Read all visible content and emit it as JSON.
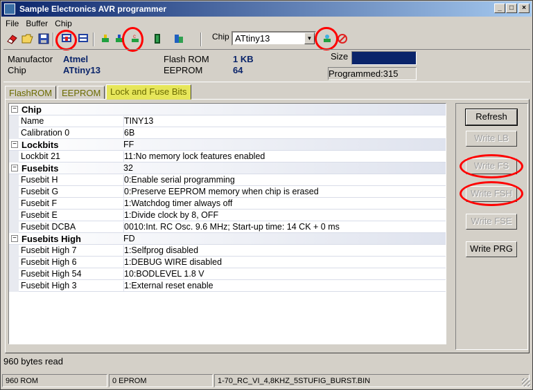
{
  "window": {
    "title": "Sample Electronics AVR programmer"
  },
  "menu": [
    "File",
    "Buffer",
    "Chip"
  ],
  "toolbar": {
    "icons": [
      "eraser-icon",
      "open-folder-icon",
      "save-disk-icon",
      "read-chip-icon",
      "compare-chip-icon",
      "program-chip-icon",
      "read-config-icon",
      "chip-icon",
      "verify-icon"
    ],
    "chip_label": "Chip",
    "chip_value": "ATtiny13"
  },
  "info": {
    "manufacturer_label": "Manufactor",
    "manufacturer_value": "Atmel",
    "chip_label": "Chip",
    "chip_value": "ATtiny13",
    "flash_label": "Flash ROM",
    "flash_value": "1 KB",
    "eeprom_label": "EEPROM",
    "eeprom_value": "64",
    "size_label": "Size",
    "size_fill_fraction": 1.0,
    "programmed": "Programmed:315"
  },
  "tabs": [
    {
      "label": "FlashROM",
      "active": false
    },
    {
      "label": "EEPROM",
      "active": false
    },
    {
      "label": "Lock and Fuse Bits",
      "active": true
    }
  ],
  "grid": {
    "rows": [
      {
        "type": "category",
        "name": "Chip",
        "value": ""
      },
      {
        "type": "item",
        "name": "Name",
        "value": "TINY13"
      },
      {
        "type": "item",
        "name": "Calibration 0",
        "value": "6B"
      },
      {
        "type": "category",
        "name": "Lockbits",
        "value": "FF"
      },
      {
        "type": "item",
        "name": "Lockbit 21",
        "value": "11:No memory lock features enabled"
      },
      {
        "type": "category",
        "name": "Fusebits",
        "value": "32"
      },
      {
        "type": "item",
        "name": "Fusebit H",
        "value": "0:Enable serial programming"
      },
      {
        "type": "item",
        "name": "Fusebit G",
        "value": "0:Preserve EEPROM memory when chip is erased"
      },
      {
        "type": "item",
        "name": "Fusebit F",
        "value": "1:Watchdog timer always off"
      },
      {
        "type": "item",
        "name": "Fusebit E",
        "value": "1:Divide clock by 8, OFF"
      },
      {
        "type": "item",
        "name": "Fusebit DCBA",
        "value": "0010:Int. RC Osc. 9.6 MHz; Start-up time: 14 CK + 0 ms"
      },
      {
        "type": "category",
        "name": "Fusebits High",
        "value": "FD"
      },
      {
        "type": "item",
        "name": "Fusebit High 7",
        "value": "1:Selfprog disabled"
      },
      {
        "type": "item",
        "name": "Fusebit High 6",
        "value": "1:DEBUG WIRE disabled"
      },
      {
        "type": "item",
        "name": "Fusebit High 54",
        "value": "10:BODLEVEL 1.8 V"
      },
      {
        "type": "item",
        "name": "Fusebit High 3",
        "value": "1:External reset enable"
      }
    ]
  },
  "buttons": {
    "refresh": "Refresh",
    "write_lb": "Write LB",
    "write_fs": "Write FS",
    "write_fsh": "Write FSH",
    "write_fse": "Write FSE",
    "write_prg": "Write PRG"
  },
  "status": {
    "message": "960 bytes read",
    "rom": "960 ROM",
    "eprom": "0 EPROM",
    "file": "1-70_RC_VI_4,8KHZ_5STUFIG_BURST.BIN"
  },
  "colors": {
    "title_start": "#0a246a",
    "title_end": "#a6caf0",
    "highlight_circle": "#ff0000",
    "active_tab": "#e6e65a",
    "value_text": "#0a246a"
  }
}
